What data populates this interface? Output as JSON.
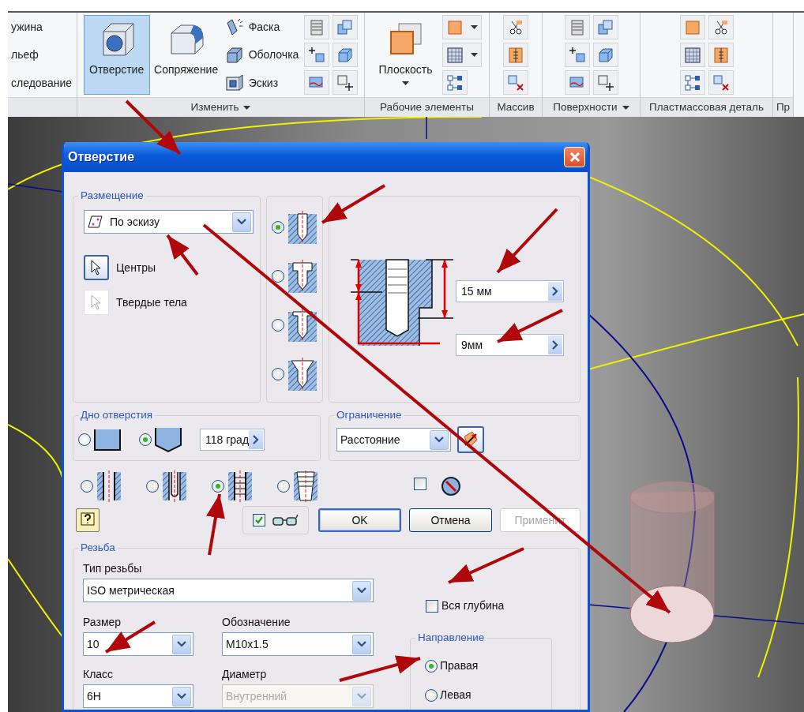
{
  "ribbon": {
    "panels": [
      {
        "menu": false,
        "tools": [
          {
            "kind": "text",
            "label": "ужина",
            "selected": false
          },
          {
            "kind": "text",
            "label": "льеф",
            "selected": false
          },
          {
            "kind": "text",
            "label": "следование",
            "selected": false
          }
        ]
      },
      {
        "title": "Изменить",
        "menu": true,
        "tools": [
          {
            "kind": "large",
            "label": "Отверстие",
            "selected": true,
            "dropdown": false
          },
          {
            "kind": "large",
            "label": "Сопряжение",
            "selected": false,
            "dropdown": false
          },
          {
            "kind": "small",
            "label": "Фаска",
            "selected": false
          },
          {
            "kind": "small",
            "label": "Оболочка",
            "selected": false
          },
          {
            "kind": "small",
            "label": "Эскиз",
            "selected": false
          },
          {
            "kind": "icon",
            "selected": false
          },
          {
            "kind": "icon",
            "selected": false
          },
          {
            "kind": "icon",
            "selected": false
          },
          {
            "kind": "icon",
            "selected": false
          },
          {
            "kind": "icon",
            "selected": false
          },
          {
            "kind": "icon",
            "selected": false
          }
        ]
      },
      {
        "title": "Рабочие элементы",
        "menu": false,
        "tools": [
          {
            "kind": "large",
            "label": "Плоскость",
            "selected": false,
            "dropdown": true
          },
          {
            "kind": "split",
            "selected": false
          },
          {
            "kind": "split",
            "selected": false
          },
          {
            "kind": "icon",
            "selected": false
          }
        ]
      },
      {
        "title": "Массив",
        "menu": false,
        "tools": [
          {
            "kind": "icon",
            "selected": false
          },
          {
            "kind": "icon",
            "selected": false
          },
          {
            "kind": "icon",
            "selected": false
          }
        ]
      },
      {
        "title": "Поверхности",
        "menu": true,
        "tools": [
          {
            "kind": "icon",
            "selected": false
          },
          {
            "kind": "icon",
            "selected": false
          },
          {
            "kind": "icon",
            "selected": false
          },
          {
            "kind": "icon",
            "selected": false
          },
          {
            "kind": "icon",
            "selected": false
          },
          {
            "kind": "icon",
            "selected": false
          }
        ]
      },
      {
        "title": "Пластмассовая деталь",
        "menu": false,
        "tools": [
          {
            "kind": "icon",
            "selected": false
          },
          {
            "kind": "icon",
            "selected": false
          },
          {
            "kind": "icon",
            "selected": false
          },
          {
            "kind": "icon",
            "selected": false
          },
          {
            "kind": "icon",
            "selected": false
          },
          {
            "kind": "icon",
            "selected": false
          }
        ]
      },
      {
        "title": "Пр",
        "menu": false
      }
    ]
  },
  "dialog": {
    "title": "Отверстие",
    "placement": {
      "legend": "Размещение",
      "value": "По эскизу",
      "options": [
        {
          "label": "Центры",
          "selected": true
        },
        {
          "label": "Твердые тела",
          "selected": false
        }
      ]
    },
    "hole_types": [
      {
        "kind": "drilled",
        "selected": true
      },
      {
        "kind": "counterbore",
        "selected": false
      },
      {
        "kind": "spotface",
        "selected": false
      },
      {
        "kind": "countersink",
        "selected": false
      }
    ],
    "depth": "15 мм",
    "diameter": "9мм",
    "bottom": {
      "legend": "Дно отверстия",
      "options": [
        {
          "kind": "flat",
          "selected": false
        },
        {
          "kind": "angle",
          "selected": true
        }
      ],
      "angle": "118 град"
    },
    "termination": {
      "legend": "Ограничение",
      "value": "Расстояние"
    },
    "hole_kinds": [
      {
        "kind": "simple",
        "selected": false
      },
      {
        "kind": "clearance",
        "selected": false
      },
      {
        "kind": "tapped",
        "selected": true
      },
      {
        "kind": "taper",
        "selected": false
      }
    ],
    "flip_checked": false,
    "preview_checked": true,
    "buttons": [
      {
        "label": "OK",
        "kind": "default",
        "disabled": false
      },
      {
        "label": "Отмена",
        "kind": "normal",
        "disabled": false
      },
      {
        "label": "Применит",
        "kind": "normal",
        "disabled": true
      }
    ],
    "thread": {
      "legend": "Резьба",
      "type_label": "Тип резьбы",
      "type_value": "ISO метрическая",
      "full_depth": {
        "label": "Вся глубина",
        "checked": false
      },
      "size_label": "Размер",
      "size_value": "10",
      "designation_label": "Обозначение",
      "designation_value": "M10x1.5",
      "class_label": "Класс",
      "class_value": "6H",
      "diameter_label": "Диаметр",
      "diameter_value": "Внутренний",
      "diameter_disabled": true,
      "direction": {
        "legend": "Направление",
        "options": [
          {
            "label": "Правая",
            "selected": true
          },
          {
            "label": "Левая",
            "selected": false
          }
        ]
      }
    }
  }
}
